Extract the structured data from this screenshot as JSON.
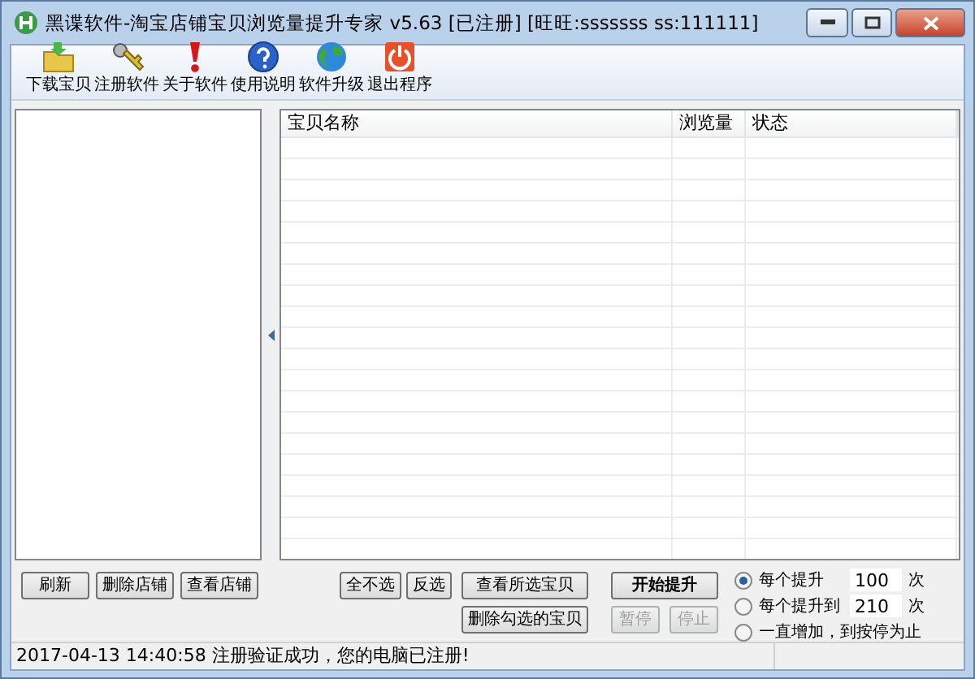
{
  "window": {
    "title": "黑谍软件-淘宝店铺宝贝浏览量提升专家 v5.63 [已注册] [旺旺:sssssss ss:111111]"
  },
  "toolbar": [
    {
      "label": "下载宝贝"
    },
    {
      "label": "注册软件"
    },
    {
      "label": "关于软件"
    },
    {
      "label": "使用说明"
    },
    {
      "label": "软件升级"
    },
    {
      "label": "退出程序"
    }
  ],
  "table": {
    "columns": [
      "宝贝名称",
      "浏览量",
      "状态"
    ]
  },
  "shop_buttons": [
    {
      "label": "刷新"
    },
    {
      "label": "删除店铺"
    },
    {
      "label": "查看店铺"
    }
  ],
  "select_buttons": [
    {
      "label": "全不选"
    },
    {
      "label": "反选"
    }
  ],
  "item_buttons": [
    {
      "label": "查看所选宝贝"
    },
    {
      "label": "删除勾选的宝贝"
    }
  ],
  "start_button": {
    "label": "开始提升",
    "disabled": false
  },
  "control_buttons": [
    {
      "label": "暂停",
      "disabled": true
    },
    {
      "label": "停止",
      "disabled": true
    }
  ],
  "modes": [
    {
      "label": "每个提升",
      "selected": true,
      "value": "100",
      "unit": "次"
    },
    {
      "label": "每个提升到",
      "selected": false,
      "value": "210",
      "unit": "次"
    },
    {
      "label": "一直增加，到按停为止",
      "selected": false
    }
  ],
  "status_bar": {
    "text": "2017-04-13 14:40:58  注册验证成功，您的电脑已注册!"
  }
}
